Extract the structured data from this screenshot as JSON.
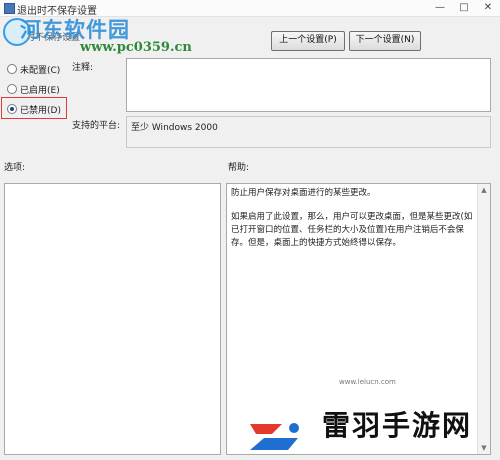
{
  "window": {
    "title": "退出时不保存设置",
    "controls": [
      "—",
      "□",
      "✕"
    ]
  },
  "subtitle": "退出时不保存设置",
  "watermarks": {
    "site": "河东软件园",
    "url": "www.pc0359.cn",
    "brand": "雷羽手游网",
    "brand_url": "www.leiucn.com"
  },
  "nav": {
    "prev_label": "上一个设置(P)",
    "next_label": "下一个设置(N)"
  },
  "options": [
    {
      "label": "未配置(C)",
      "selected": false
    },
    {
      "label": "已启用(E)",
      "selected": false
    },
    {
      "label": "已禁用(D)",
      "selected": true
    }
  ],
  "comment_label": "注释:",
  "platform_label": "支持的平台:",
  "platform_value": "至少 Windows 2000",
  "options_label": "选项:",
  "help_label": "帮助:",
  "help": [
    "防止用户保存对桌面进行的某些更改。",
    "如果启用了此设置，那么，用户可以更改桌面，但是某些更改(如已打开窗口的位置、任务栏的大小及位置)在用户注销后不会保存。但是，桌面上的快捷方式始终得以保存。"
  ]
}
